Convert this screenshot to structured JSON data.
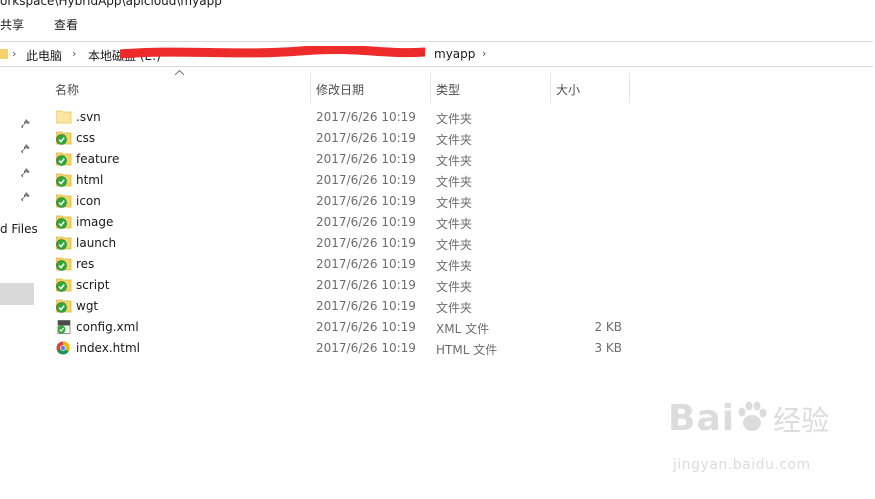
{
  "window": {
    "path_title": "orkspace\\HybridApp\\apicloud\\myapp"
  },
  "ribbon": {
    "tabs": [
      {
        "label": "共享"
      },
      {
        "label": "查看"
      }
    ]
  },
  "address": {
    "crumbs": [
      {
        "label": "此电脑"
      },
      {
        "label": "本地磁盘 (E:)"
      },
      {
        "label": "myapp"
      }
    ]
  },
  "columns": {
    "name": "名称",
    "date": "修改日期",
    "type": "类型",
    "size": "大小"
  },
  "nav": {
    "partial_label": "d Files"
  },
  "files": [
    {
      "name": ".svn",
      "date": "2017/6/26 10:19",
      "type": "文件夹",
      "size": "",
      "icon": "folder-icon"
    },
    {
      "name": "css",
      "date": "2017/6/26 10:19",
      "type": "文件夹",
      "size": "",
      "icon": "svn-folder-icon"
    },
    {
      "name": "feature",
      "date": "2017/6/26 10:19",
      "type": "文件夹",
      "size": "",
      "icon": "svn-folder-icon"
    },
    {
      "name": "html",
      "date": "2017/6/26 10:19",
      "type": "文件夹",
      "size": "",
      "icon": "svn-folder-icon"
    },
    {
      "name": "icon",
      "date": "2017/6/26 10:19",
      "type": "文件夹",
      "size": "",
      "icon": "svn-folder-icon"
    },
    {
      "name": "image",
      "date": "2017/6/26 10:19",
      "type": "文件夹",
      "size": "",
      "icon": "svn-folder-icon"
    },
    {
      "name": "launch",
      "date": "2017/6/26 10:19",
      "type": "文件夹",
      "size": "",
      "icon": "svn-folder-icon"
    },
    {
      "name": "res",
      "date": "2017/6/26 10:19",
      "type": "文件夹",
      "size": "",
      "icon": "svn-folder-icon"
    },
    {
      "name": "script",
      "date": "2017/6/26 10:19",
      "type": "文件夹",
      "size": "",
      "icon": "svn-folder-icon"
    },
    {
      "name": "wgt",
      "date": "2017/6/26 10:19",
      "type": "文件夹",
      "size": "",
      "icon": "svn-folder-icon"
    },
    {
      "name": "config.xml",
      "date": "2017/6/26 10:19",
      "type": "XML 文件",
      "size": "2 KB",
      "icon": "xml-file-icon"
    },
    {
      "name": "index.html",
      "date": "2017/6/26 10:19",
      "type": "HTML 文件",
      "size": "3 KB",
      "icon": "chrome-html-icon"
    }
  ],
  "watermark": {
    "logo": "Bai",
    "logo_cn": "经验",
    "url": "jingyan.baidu.com"
  },
  "colors": {
    "folder": "#f3d36c",
    "svn_check": "#2fa83a",
    "redaction": "#ee2b2b",
    "selection": "#d9d9d9"
  }
}
